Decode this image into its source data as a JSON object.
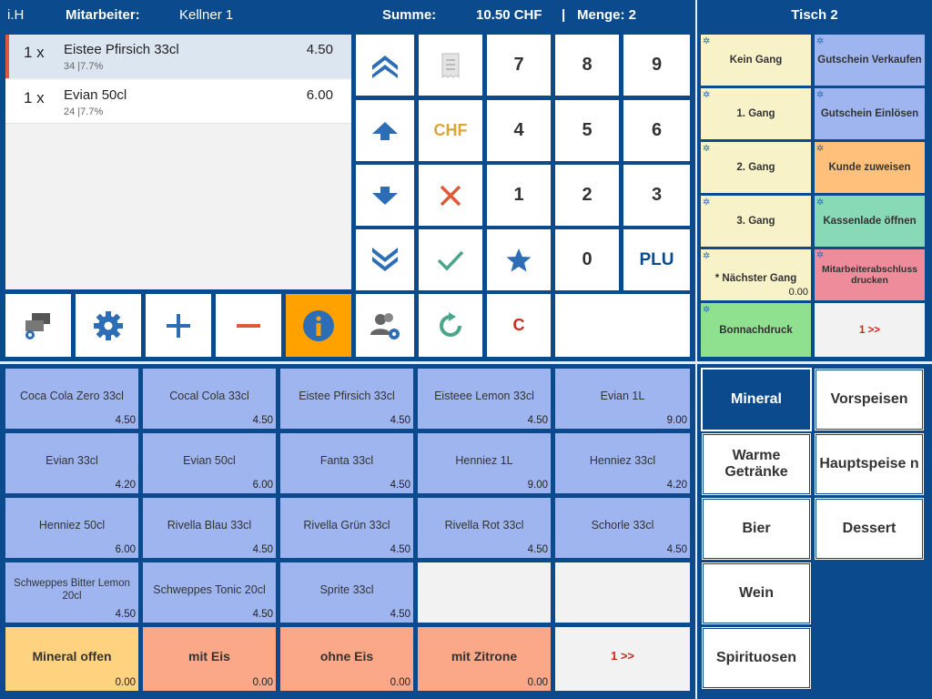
{
  "header": {
    "brand": "i.H",
    "employee_label": "Mitarbeiter:",
    "employee_name": "Kellner 1",
    "sum_label": "Summe:",
    "sum_value": "10.50 CHF",
    "separator": "|",
    "count_label": "Menge: 2",
    "table": "Tisch 2"
  },
  "order_items": [
    {
      "qty": "1 x",
      "name": "Eistee Pfirsich 33cl",
      "sub": "34 |7.7%",
      "price": "4.50"
    },
    {
      "qty": "1 x",
      "name": "Evian 50cl",
      "sub": "24 |7.7%",
      "price": "6.00"
    }
  ],
  "keypad": {
    "k7": "7",
    "k8": "8",
    "k9": "9",
    "k4": "4",
    "k5": "5",
    "k6": "6",
    "k1": "1",
    "k2": "2",
    "k3": "3",
    "k0": "0",
    "plu": "PLU",
    "chf": "CHF",
    "clear": "C"
  },
  "function_buttons": [
    {
      "label": "Kein Gang",
      "value": ""
    },
    {
      "label": "Gutschein Verkaufen",
      "value": ""
    },
    {
      "label": "1. Gang",
      "value": ""
    },
    {
      "label": "Gutschein Einlösen",
      "value": ""
    },
    {
      "label": "2. Gang",
      "value": ""
    },
    {
      "label": "Kunde zuweisen",
      "value": ""
    },
    {
      "label": "3. Gang",
      "value": ""
    },
    {
      "label": "Kassenlade öffnen",
      "value": ""
    },
    {
      "label": "* Nächster Gang",
      "value": "0.00"
    },
    {
      "label": "Mitarbeiterabschluss drucken",
      "value": ""
    },
    {
      "label": "Bonnachdruck",
      "value": ""
    },
    {
      "label": "1 >>",
      "value": ""
    }
  ],
  "products": [
    {
      "name": "Coca Cola Zero 33cl",
      "price": "4.50"
    },
    {
      "name": "Cocal Cola 33cl",
      "price": "4.50"
    },
    {
      "name": "Eistee Pfirsich 33cl",
      "price": "4.50"
    },
    {
      "name": "Eisteee Lemon 33cl",
      "price": "4.50"
    },
    {
      "name": "Evian 1L",
      "price": "9.00"
    },
    {
      "name": "Evian 33cl",
      "price": "4.20"
    },
    {
      "name": "Evian 50cl",
      "price": "6.00"
    },
    {
      "name": "Fanta 33cl",
      "price": "4.50"
    },
    {
      "name": "Henniez 1L",
      "price": "9.00"
    },
    {
      "name": "Henniez 33cl",
      "price": "4.20"
    },
    {
      "name": "Henniez 50cl",
      "price": "6.00"
    },
    {
      "name": "Rivella Blau 33cl",
      "price": "4.50"
    },
    {
      "name": "Rivella Grün 33cl",
      "price": "4.50"
    },
    {
      "name": "Rivella Rot 33cl",
      "price": "4.50"
    },
    {
      "name": "Schorle 33cl",
      "price": "4.50"
    },
    {
      "name": "Schweppes Bitter Lemon 20cl",
      "price": "4.50"
    },
    {
      "name": "Schweppes Tonic 20cl",
      "price": "4.50"
    },
    {
      "name": "Sprite 33cl",
      "price": "4.50"
    },
    {
      "name": "",
      "price": ""
    },
    {
      "name": "",
      "price": ""
    },
    {
      "name": "Mineral offen",
      "price": "0.00"
    },
    {
      "name": "mit Eis",
      "price": "0.00"
    },
    {
      "name": "ohne Eis",
      "price": "0.00"
    },
    {
      "name": "mit Zitrone",
      "price": "0.00"
    },
    {
      "name": "1 >>",
      "price": ""
    }
  ],
  "categories": [
    {
      "label": "Mineral"
    },
    {
      "label": "Vorspeisen"
    },
    {
      "label": "Warme Getränke"
    },
    {
      "label": "Hauptspeise n"
    },
    {
      "label": "Bier"
    },
    {
      "label": "Dessert"
    },
    {
      "label": "Wein"
    },
    {
      "label": "Spirituosen"
    }
  ],
  "colors": {
    "frame": "#0b4a8c",
    "product": "#9eb5f0",
    "course": "#f7f2c8",
    "voucher": "#9eb5f0",
    "customer": "#ffc07c",
    "drawer": "#88d9b5",
    "employee_close": "#ef8c9b",
    "reprint": "#8fe08f",
    "info_button": "#ffa200",
    "mineral_open": "#ffd27f",
    "modifier": "#fba888",
    "next_page": "#cc2a1a"
  }
}
